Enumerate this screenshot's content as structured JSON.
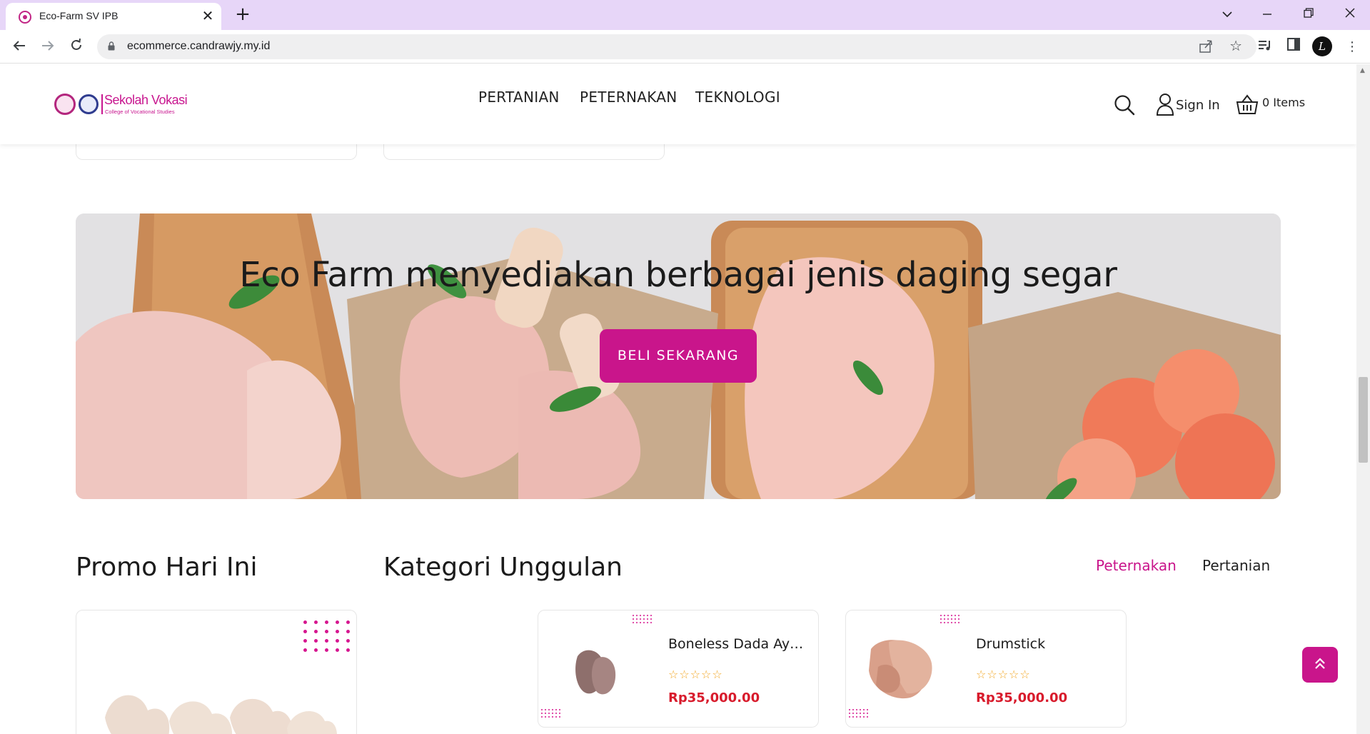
{
  "browser": {
    "tab_title": "Eco-Farm SV IPB",
    "url": "ecommerce.candrawjy.my.id",
    "profile_initial": "L"
  },
  "logo": {
    "name": "Sekolah Vokasi",
    "subtitle": "College of Vocational Studies"
  },
  "nav": {
    "items": [
      {
        "label": "PERTANIAN"
      },
      {
        "label": "PETERNAKAN"
      },
      {
        "label": "TEKNOLOGI"
      }
    ],
    "sign_in": "Sign In",
    "cart": "0 Items"
  },
  "banner": {
    "headline": "Eco Farm menyediakan berbagai jenis daging segar",
    "cta": "BELI SEKARANG"
  },
  "promo": {
    "title": "Promo Hari Ini"
  },
  "featured": {
    "title": "Kategori Unggulan",
    "tabs": [
      {
        "label": "Peternakan",
        "active": true
      },
      {
        "label": "Pertanian",
        "active": false
      }
    ],
    "products": [
      {
        "name": "Boneless Dada Ayam",
        "rating": 0,
        "stars": "☆☆☆☆☆",
        "price": "Rp35,000.00"
      },
      {
        "name": "Drumstick",
        "rating": 0,
        "stars": "☆☆☆☆☆",
        "price": "Rp35,000.00"
      }
    ]
  },
  "colors": {
    "brand": "#c9158b",
    "price": "#d81b2c",
    "star": "#f2a623",
    "tabstrip": "#e7d6f8"
  },
  "icons": {
    "back": "arrow-left-icon",
    "forward": "arrow-right-icon",
    "reload": "reload-icon",
    "search": "search-icon",
    "user": "user-icon",
    "cart": "basket-icon",
    "scroll_top": "double-chevron-up-icon"
  }
}
